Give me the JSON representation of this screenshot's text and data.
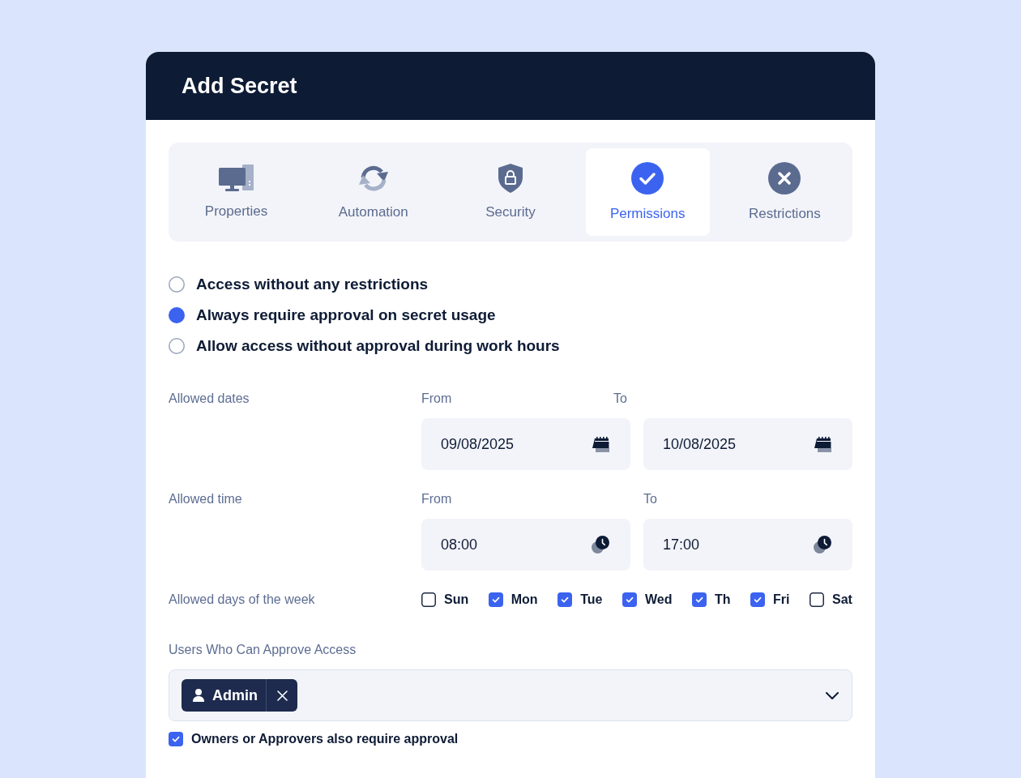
{
  "dialog": {
    "title": "Add Secret"
  },
  "tabs": [
    {
      "label": "Properties",
      "selected": false
    },
    {
      "label": "Automation",
      "selected": false
    },
    {
      "label": "Security",
      "selected": false
    },
    {
      "label": "Permissions",
      "selected": true
    },
    {
      "label": "Restrictions",
      "selected": false
    }
  ],
  "access_options": [
    {
      "label": "Access without any restrictions",
      "selected": false
    },
    {
      "label": "Always require approval on secret usage",
      "selected": true
    },
    {
      "label": "Allow access without approval during work hours",
      "selected": false
    }
  ],
  "schedule": [
    {
      "kind": "date",
      "label": "Allowed dates",
      "from_label": "From",
      "to_label": "To",
      "from_value": "09/08/2025",
      "to_value": "10/08/2025"
    },
    {
      "kind": "time",
      "label": "Allowed time",
      "from_label": "From",
      "to_label": "To",
      "from_value": "08:00",
      "to_value": "17:00"
    }
  ],
  "days": {
    "label": "Allowed days of the week",
    "items": [
      {
        "label": "Sun",
        "checked": false
      },
      {
        "label": "Mon",
        "checked": true
      },
      {
        "label": "Tue",
        "checked": true
      },
      {
        "label": "Wed",
        "checked": true
      },
      {
        "label": "Th",
        "checked": true
      },
      {
        "label": "Fri",
        "checked": true
      },
      {
        "label": "Sat",
        "checked": false
      }
    ]
  },
  "approvers": {
    "label": "Users Who Can Approve Access",
    "chips": [
      {
        "label": "Admin"
      }
    ]
  },
  "owners_require_approval": {
    "label": "Owners or Approvers also require approval",
    "checked": true
  }
}
